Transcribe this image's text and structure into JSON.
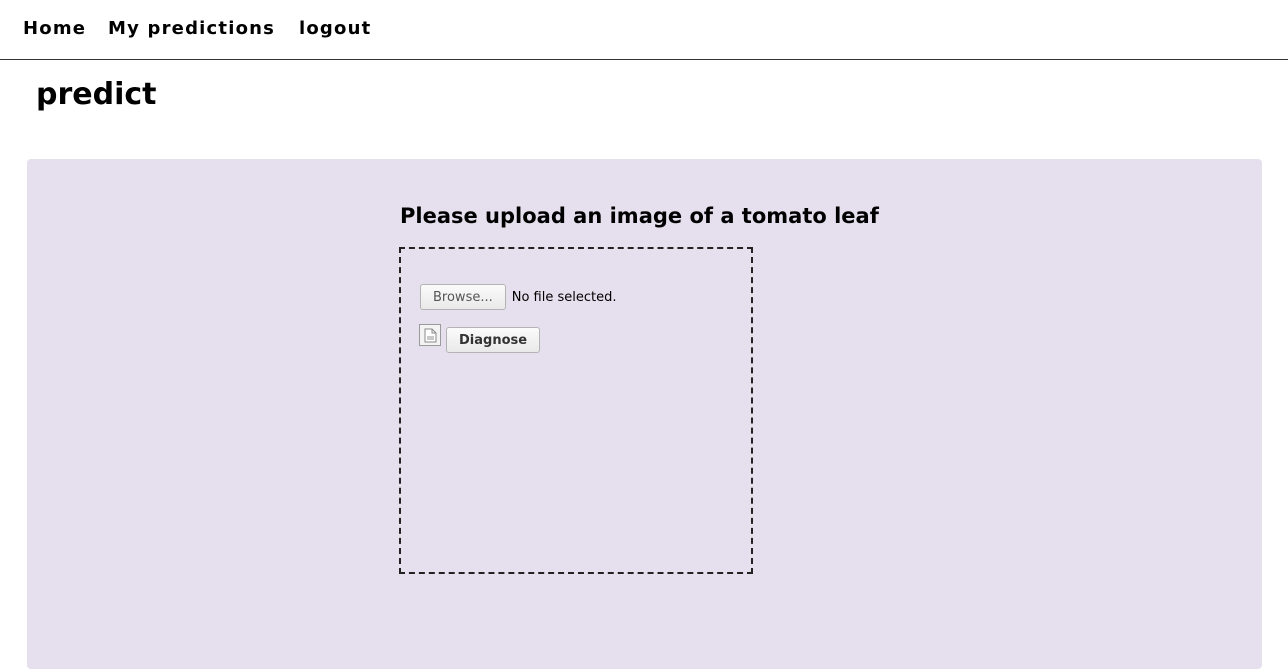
{
  "nav": {
    "home": "Home",
    "predictions": "My predictions",
    "logout": "logout"
  },
  "page": {
    "title": "predict"
  },
  "upload": {
    "heading": "Please upload an image of a tomato leaf",
    "browse_label": "Browse...",
    "file_status": "No file selected.",
    "diagnose_label": "Diagnose",
    "preview_icon": "broken-image-icon"
  },
  "colors": {
    "panel_background": "#e6e0ee",
    "nav_border": "#333333"
  }
}
